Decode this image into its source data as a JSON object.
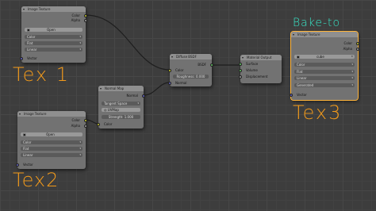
{
  "nodes": {
    "tex1": {
      "title": "Image Texture",
      "out_color": "Color",
      "out_alpha": "Alpha",
      "open": "Open",
      "color_space": "Color",
      "projection": "Flat",
      "interpolation": "Linear",
      "in_vector": "Vector"
    },
    "tex2": {
      "title": "Image Texture",
      "out_color": "Color",
      "out_alpha": "Alpha",
      "open": "Open",
      "color_space": "Color",
      "projection": "Flat",
      "interpolation": "Linear",
      "in_vector": "Vector"
    },
    "tex3": {
      "title": "Image Texture",
      "out_color": "Color",
      "out_alpha": "Alpha",
      "image": "cube",
      "color_space": "Color",
      "projection": "Flat",
      "interpolation": "Linear",
      "generated": "Generated",
      "in_vector": "Vector"
    },
    "normal_map": {
      "title": "Normal Map",
      "out_normal": "Normal",
      "space": "Tangent Space",
      "uv_map": "UVMap",
      "strength_label": "Strength:",
      "strength_value": "1.000",
      "in_color": "Color"
    },
    "diffuse": {
      "title": "Diffuse BSDF",
      "out_bsdf": "BSDF",
      "in_color": "Color",
      "roughness_label": "Roughness:",
      "roughness_value": "0.000",
      "in_normal": "Normal"
    },
    "output": {
      "title": "Material Output",
      "in_surface": "Surface",
      "in_volume": "Volume",
      "in_displacement": "Displacement"
    }
  },
  "annotations": {
    "tex1": "Tex 1",
    "tex2": "Tex2",
    "tex3": "Tex3",
    "bake": "Bake-to"
  },
  "colors": {
    "annotation_orange": "#f29a1b",
    "annotation_cyan": "#37e6c7",
    "selected_outline": "#ffb43a",
    "socket_color": "#c7c729",
    "socket_float": "#a1a1a1",
    "socket_vector": "#6363c7",
    "socket_shader": "#63c763"
  }
}
